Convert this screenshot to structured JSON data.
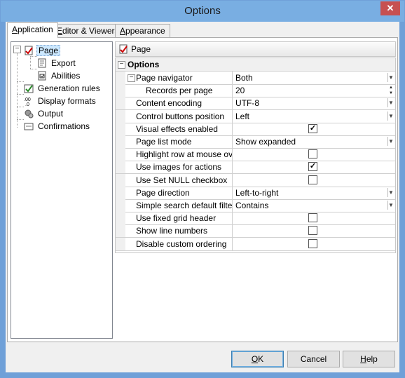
{
  "window": {
    "title": "Options",
    "close_glyph": "✕"
  },
  "tabs": [
    {
      "label": "Application",
      "underline": "A",
      "rest": "pplication",
      "active": true
    },
    {
      "label": "Editor & Viewers",
      "underline": "E",
      "rest": "ditor & Viewers",
      "active": false
    },
    {
      "label": "Appearance",
      "underline": "A",
      "rest": "ppearance",
      "active": false
    }
  ],
  "tree": {
    "items": [
      {
        "label": "Page",
        "icon": "page-icon",
        "selected": true
      },
      {
        "label": "Export",
        "icon": "export-icon"
      },
      {
        "label": "Abilities",
        "icon": "abilities-icon"
      },
      {
        "label": "Generation rules",
        "icon": "generation-rules-icon"
      },
      {
        "label": "Display formats",
        "icon": "display-formats-icon"
      },
      {
        "label": "Output",
        "icon": "output-icon"
      },
      {
        "label": "Confirmations",
        "icon": "confirmations-icon"
      }
    ]
  },
  "panel": {
    "header": "Page",
    "category": "Options",
    "rows": [
      {
        "name": "Page navigator",
        "value": "Both",
        "type": "dropdown",
        "expander": true
      },
      {
        "name": "Records per page",
        "value": "20",
        "type": "spin",
        "indent": true
      },
      {
        "name": "Content encoding",
        "value": "UTF-8",
        "type": "dropdown"
      },
      {
        "name": "Control buttons position",
        "value": "Left",
        "type": "dropdown"
      },
      {
        "name": "Visual effects enabled",
        "value": "",
        "type": "checkbox",
        "checked": true
      },
      {
        "name": "Page list mode",
        "value": "Show expanded",
        "type": "dropdown"
      },
      {
        "name": "Highlight row at mouse over",
        "value": "",
        "type": "checkbox",
        "checked": false
      },
      {
        "name": "Use images for actions",
        "value": "",
        "type": "checkbox",
        "checked": true
      },
      {
        "name": "Use Set NULL checkbox",
        "value": "",
        "type": "checkbox",
        "checked": false
      },
      {
        "name": "Page direction",
        "value": "Left-to-right",
        "type": "dropdown"
      },
      {
        "name": "Simple search default filter",
        "value": "Contains",
        "type": "dropdown"
      },
      {
        "name": "Use fixed grid header",
        "value": "",
        "type": "checkbox",
        "checked": false
      },
      {
        "name": "Show line numbers",
        "value": "",
        "type": "checkbox",
        "checked": false
      },
      {
        "name": "Disable custom ordering",
        "value": "",
        "type": "checkbox",
        "checked": false
      }
    ]
  },
  "buttons": {
    "ok": {
      "label": "OK",
      "underline": "O",
      "rest": "K"
    },
    "cancel": {
      "label": "Cancel"
    },
    "help": {
      "label": "Help",
      "underline": "H",
      "rest": "elp"
    }
  },
  "colors": {
    "titlebar": "#79aee2",
    "close": "#c75050",
    "selection": "#cce8ff"
  }
}
